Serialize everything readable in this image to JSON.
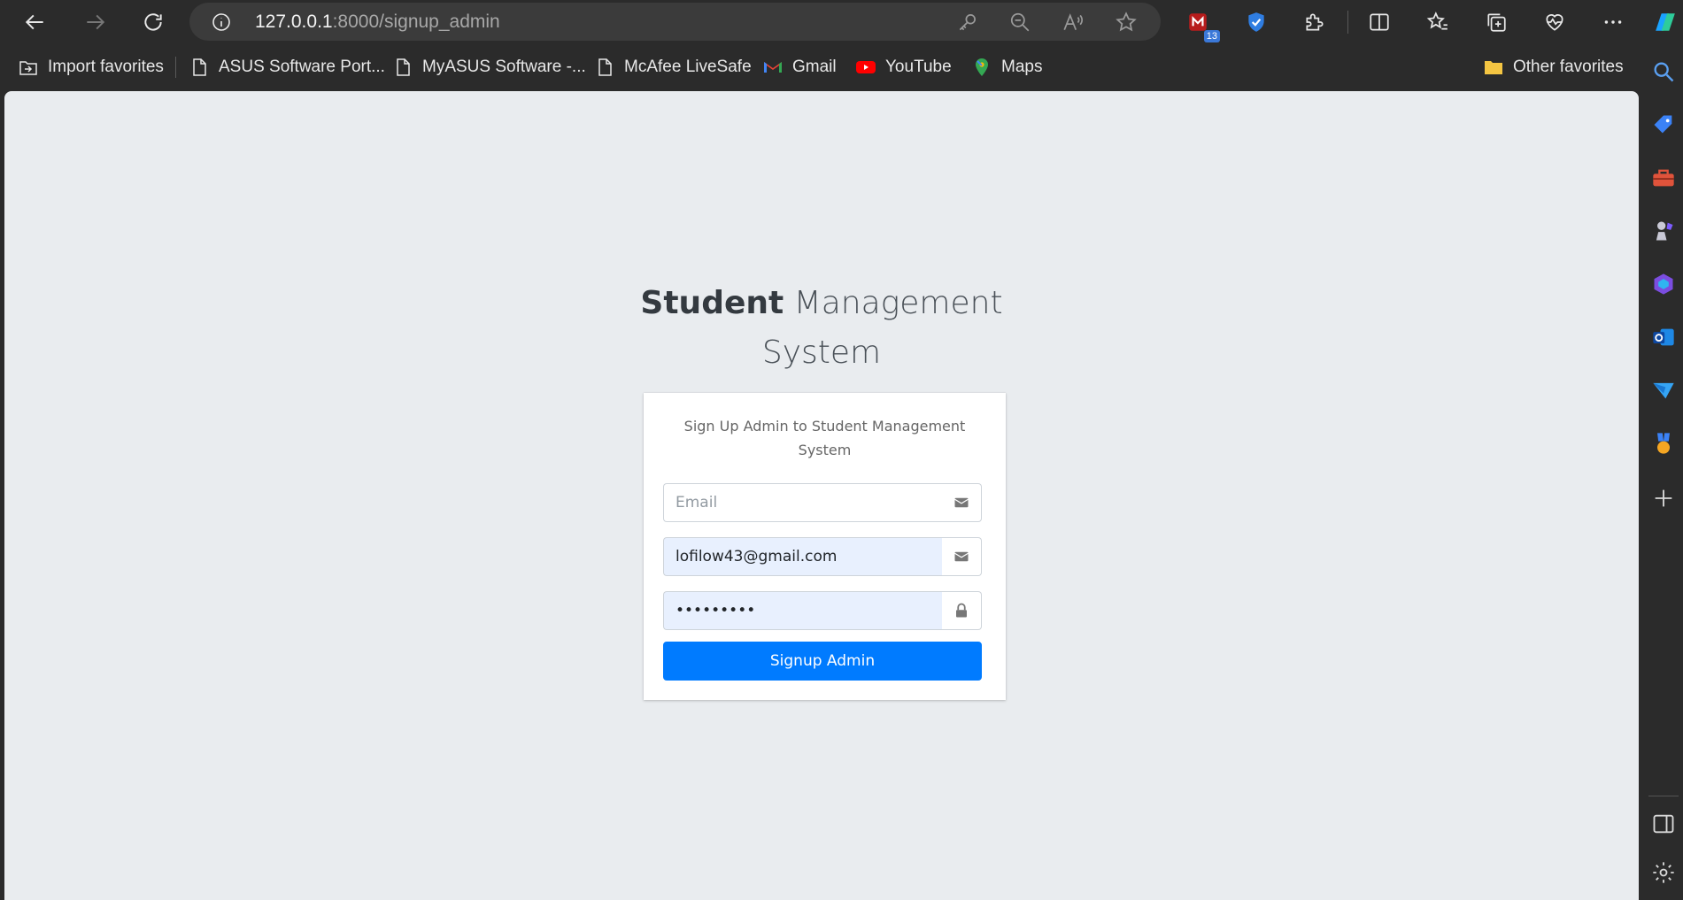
{
  "browser": {
    "url_host": "127.0.0.1",
    "url_rest": ":8000/signup_admin",
    "extension_badge": "13"
  },
  "bookmarks": {
    "items": [
      {
        "label": "Import favorites",
        "icon": "import-icon"
      },
      {
        "label": "ASUS Software Port...",
        "icon": "page-icon"
      },
      {
        "label": "MyASUS Software -...",
        "icon": "page-icon"
      },
      {
        "label": "McAfee LiveSafe",
        "icon": "page-icon"
      },
      {
        "label": "Gmail",
        "icon": "gmail-icon"
      },
      {
        "label": "YouTube",
        "icon": "youtube-icon"
      },
      {
        "label": "Maps",
        "icon": "maps-icon"
      }
    ],
    "other": "Other favorites"
  },
  "login": {
    "logo_bold": "Student",
    "logo_rest": "Management",
    "logo_line2": "System",
    "message": "Sign Up Admin to Student Management System",
    "email_placeholder": "Email",
    "email_value": "",
    "username_value": "lofilow43@gmail.com",
    "password_value": "•••••••••",
    "submit_label": "Signup Admin"
  },
  "colors": {
    "primary": "#007bff",
    "page_bg": "#e9ecef",
    "autofill_bg": "#e8f0fe",
    "chrome_bg": "#2b2b2b"
  }
}
